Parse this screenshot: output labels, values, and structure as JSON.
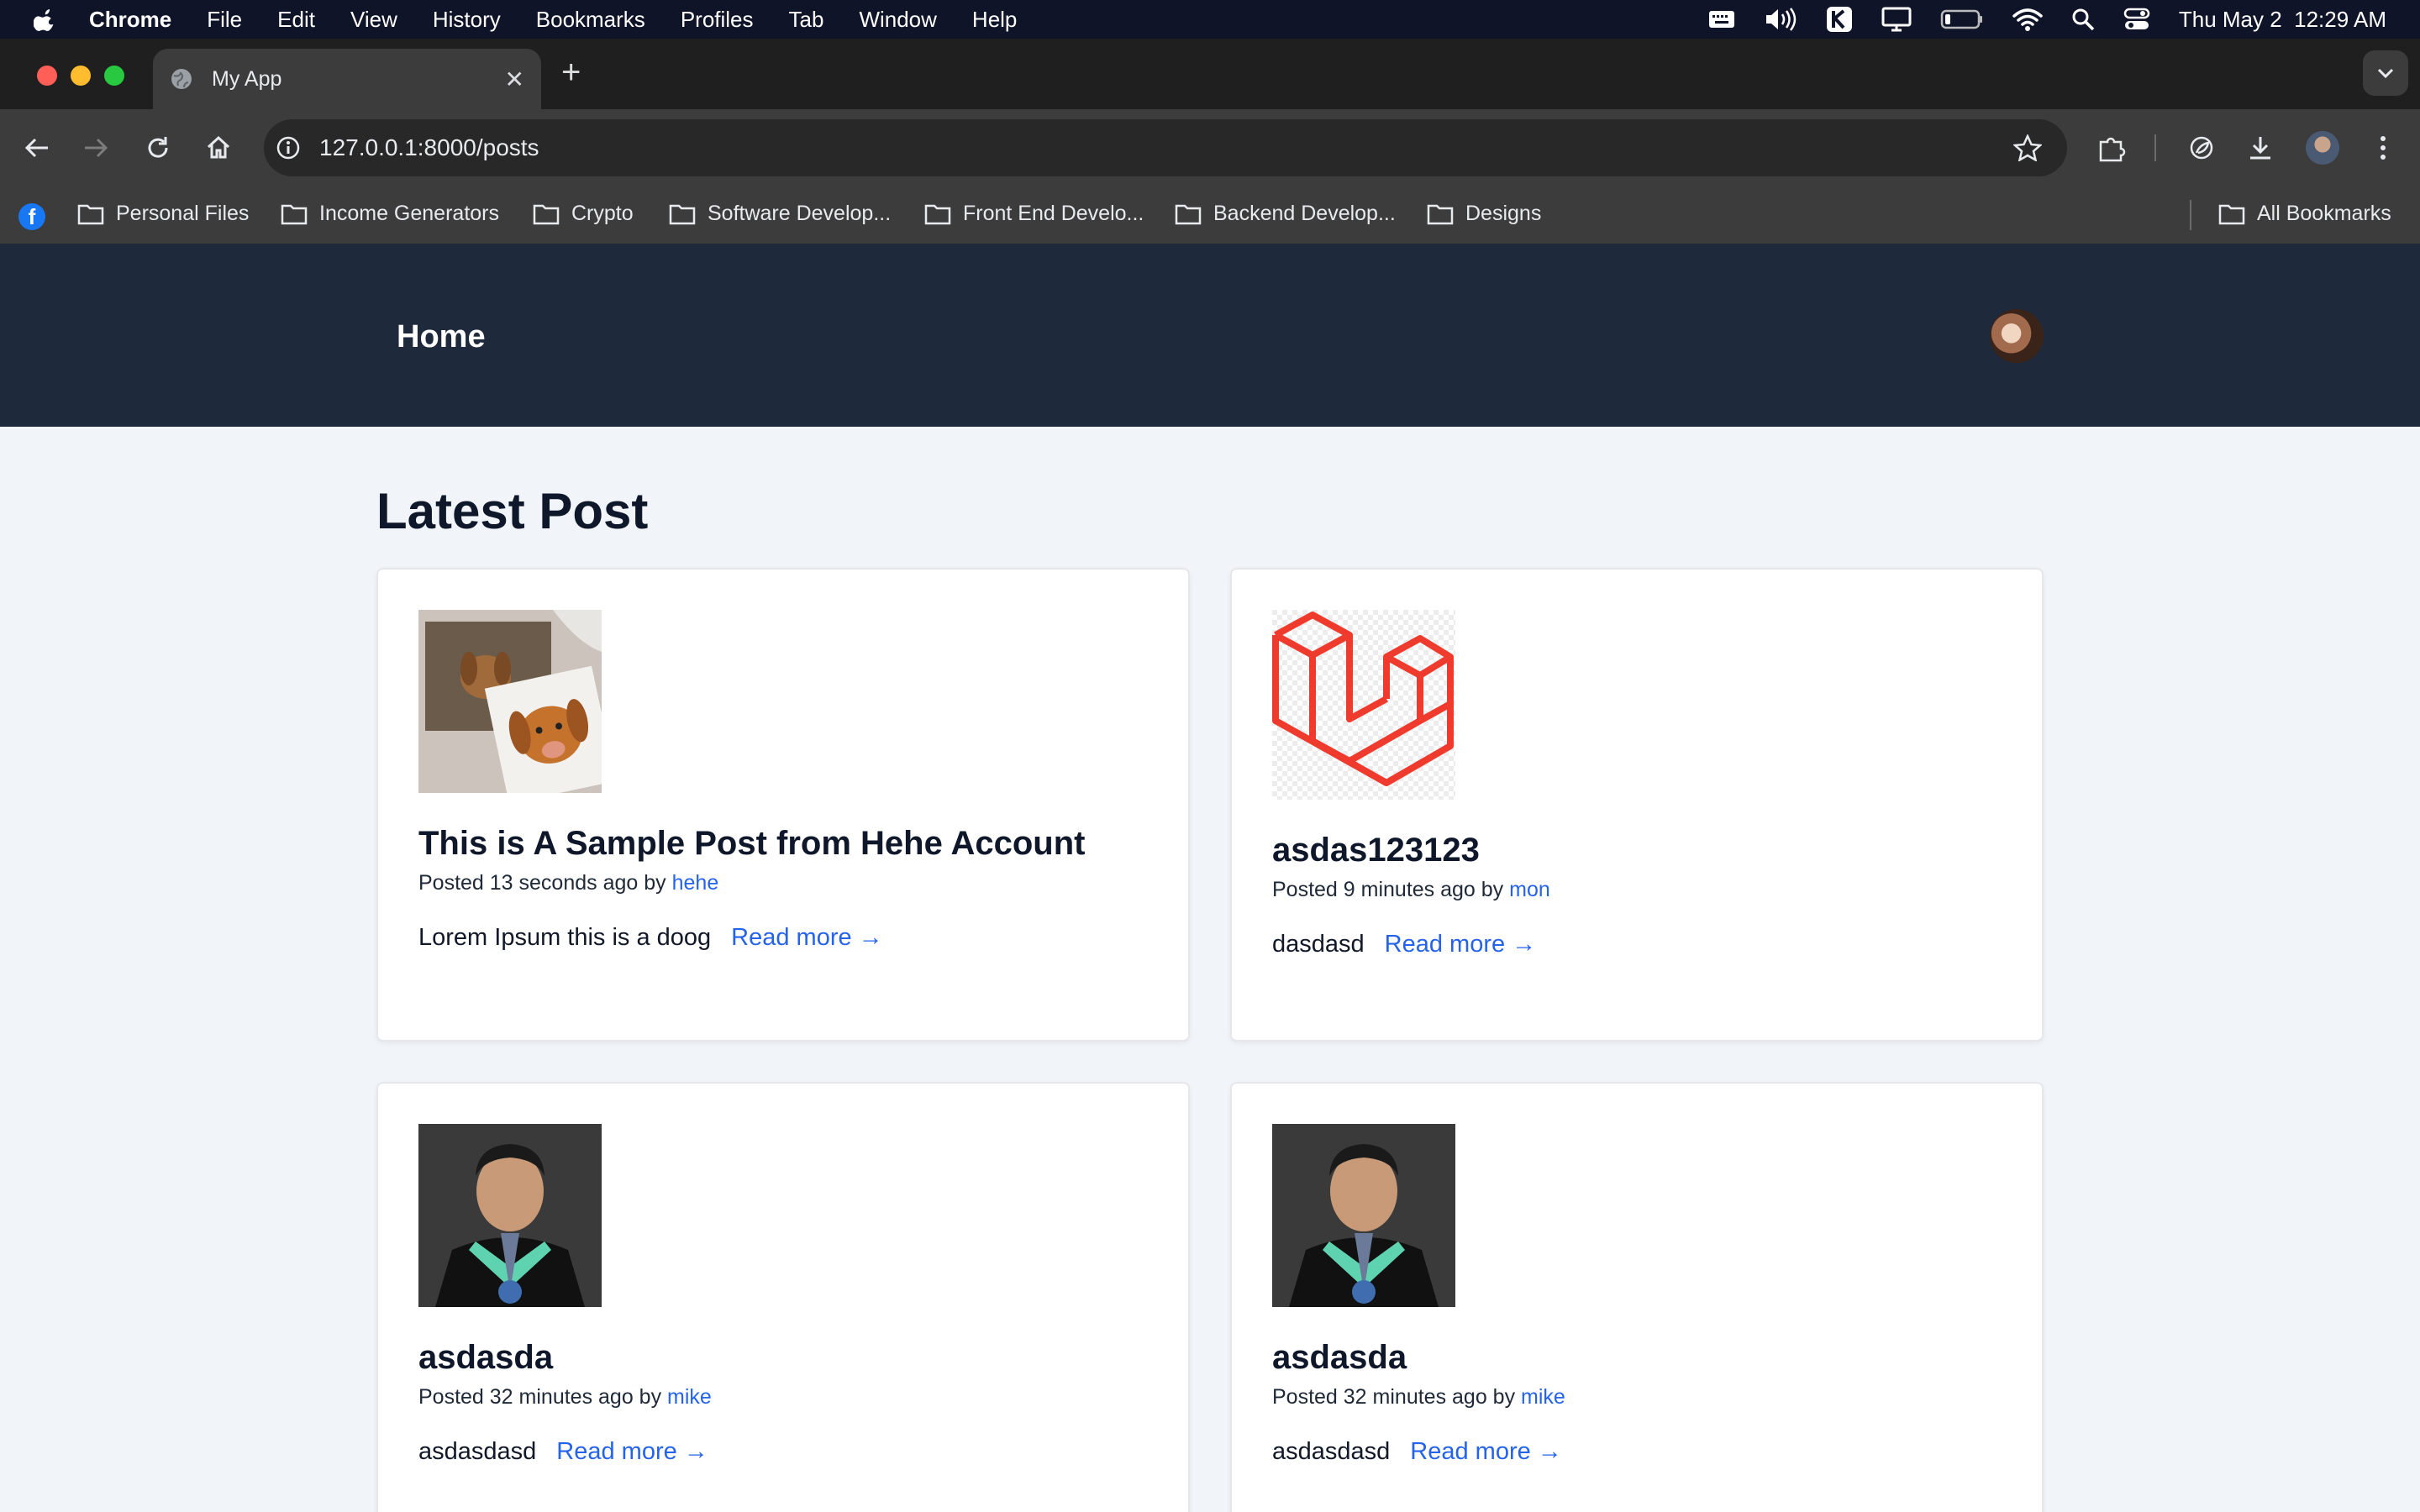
{
  "os_menubar": {
    "app_name": "Chrome",
    "menus": [
      "File",
      "Edit",
      "View",
      "History",
      "Bookmarks",
      "Profiles",
      "Tab",
      "Window",
      "Help"
    ],
    "clock": "Thu May 2  12:29 AM"
  },
  "browser": {
    "tab_title": "My App",
    "url": "127.0.0.1:8000/posts",
    "bookmarks": [
      "Personal Files",
      "Income Generators",
      "Crypto",
      "Software Develop...",
      "Front End Develo...",
      "Backend Develop...",
      "Designs"
    ],
    "all_bookmarks": "All Bookmarks"
  },
  "page": {
    "nav_home": "Home",
    "heading": "Latest Post",
    "posts": [
      {
        "title": "This is A Sample Post from Hehe Account",
        "time": "Posted 13 seconds ago by",
        "author": "hehe",
        "excerpt": "Lorem Ipsum this is a doog",
        "read_more": "Read more →",
        "image": "dog-photo"
      },
      {
        "title": "asdas123123",
        "time": "Posted 9 minutes ago by",
        "author": "mon",
        "excerpt": "dasdasd",
        "read_more": "Read more →",
        "image": "laravel-logo"
      },
      {
        "title": "asdasda",
        "time": "Posted 32 minutes ago by",
        "author": "mike",
        "excerpt": "asdasdasd",
        "read_more": "Read more →",
        "image": "graduation-portrait"
      },
      {
        "title": "asdasda",
        "time": "Posted 32 minutes ago by",
        "author": "mike",
        "excerpt": "asdasdasd",
        "read_more": "Read more →",
        "image": "graduation-portrait"
      }
    ]
  },
  "colors": {
    "nav_bg": "#1e293b",
    "page_bg": "#f1f5f9",
    "link": "#2563eb",
    "laravel_red": "#ef3b2d"
  }
}
